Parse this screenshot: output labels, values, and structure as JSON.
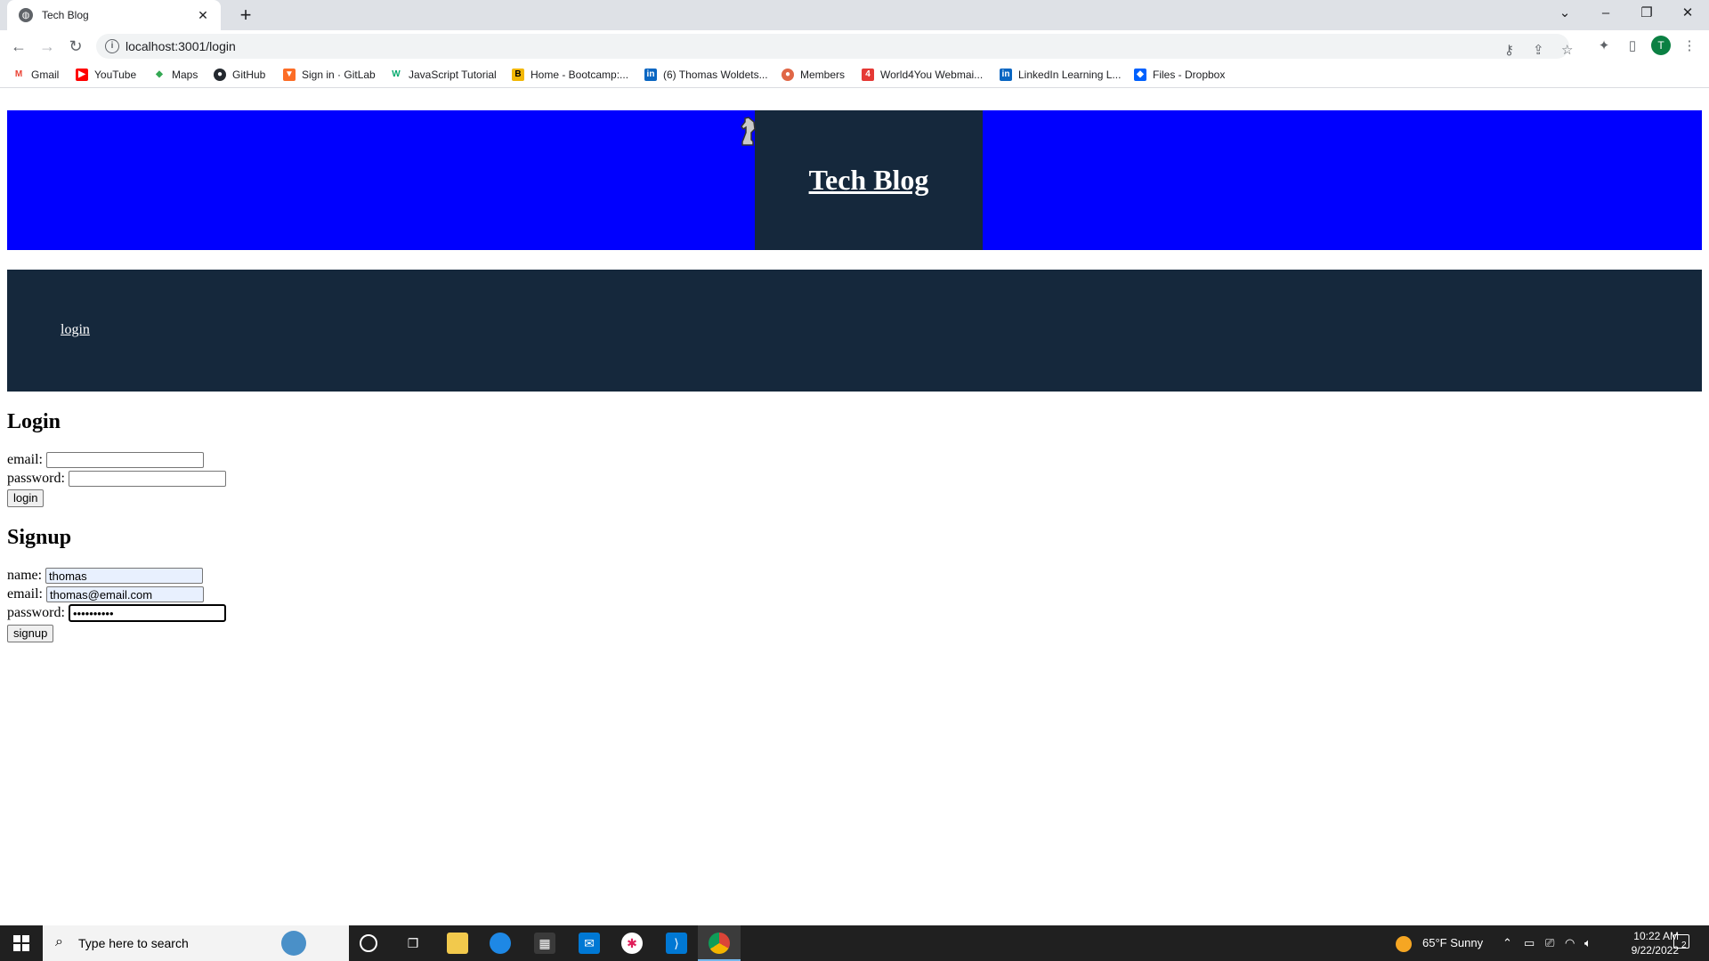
{
  "browser": {
    "tab_title": "Tech Blog",
    "url": "localhost:3001/login",
    "avatar_initial": "T",
    "bookmarks": [
      {
        "label": "Gmail",
        "icon": "gmail-icon"
      },
      {
        "label": "YouTube",
        "icon": "youtube-icon"
      },
      {
        "label": "Maps",
        "icon": "maps-icon"
      },
      {
        "label": "GitHub",
        "icon": "github-icon"
      },
      {
        "label": "Sign in · GitLab",
        "icon": "gitlab-icon"
      },
      {
        "label": "JavaScript Tutorial",
        "icon": "w3schools-icon"
      },
      {
        "label": "Home - Bootcamp:...",
        "icon": "bootcamp-icon"
      },
      {
        "label": "(6) Thomas Woldets...",
        "icon": "linkedin-icon"
      },
      {
        "label": "Members",
        "icon": "members-icon"
      },
      {
        "label": "World4You Webmai...",
        "icon": "world4you-icon"
      },
      {
        "label": "LinkedIn Learning L...",
        "icon": "linkedin-icon"
      },
      {
        "label": "Files - Dropbox",
        "icon": "dropbox-icon"
      }
    ]
  },
  "site": {
    "title": "Tech Blog",
    "nav_login": "login"
  },
  "login": {
    "heading": "Login",
    "email_label": "email:",
    "email_value": "",
    "password_label": "password:",
    "password_value": "",
    "button": "login"
  },
  "signup": {
    "heading": "Signup",
    "name_label": "name:",
    "name_value": "thomas",
    "email_label": "email:",
    "email_value": "thomas@email.com",
    "password_label": "password:",
    "password_value": "••••••••••",
    "button": "signup"
  },
  "taskbar": {
    "search_placeholder": "Type here to search",
    "weather": "65°F  Sunny",
    "time": "10:22 AM",
    "date": "9/22/2022",
    "notifications": "2"
  },
  "colors": {
    "header_blue": "#0000ff",
    "header_navy": "#15283c"
  }
}
